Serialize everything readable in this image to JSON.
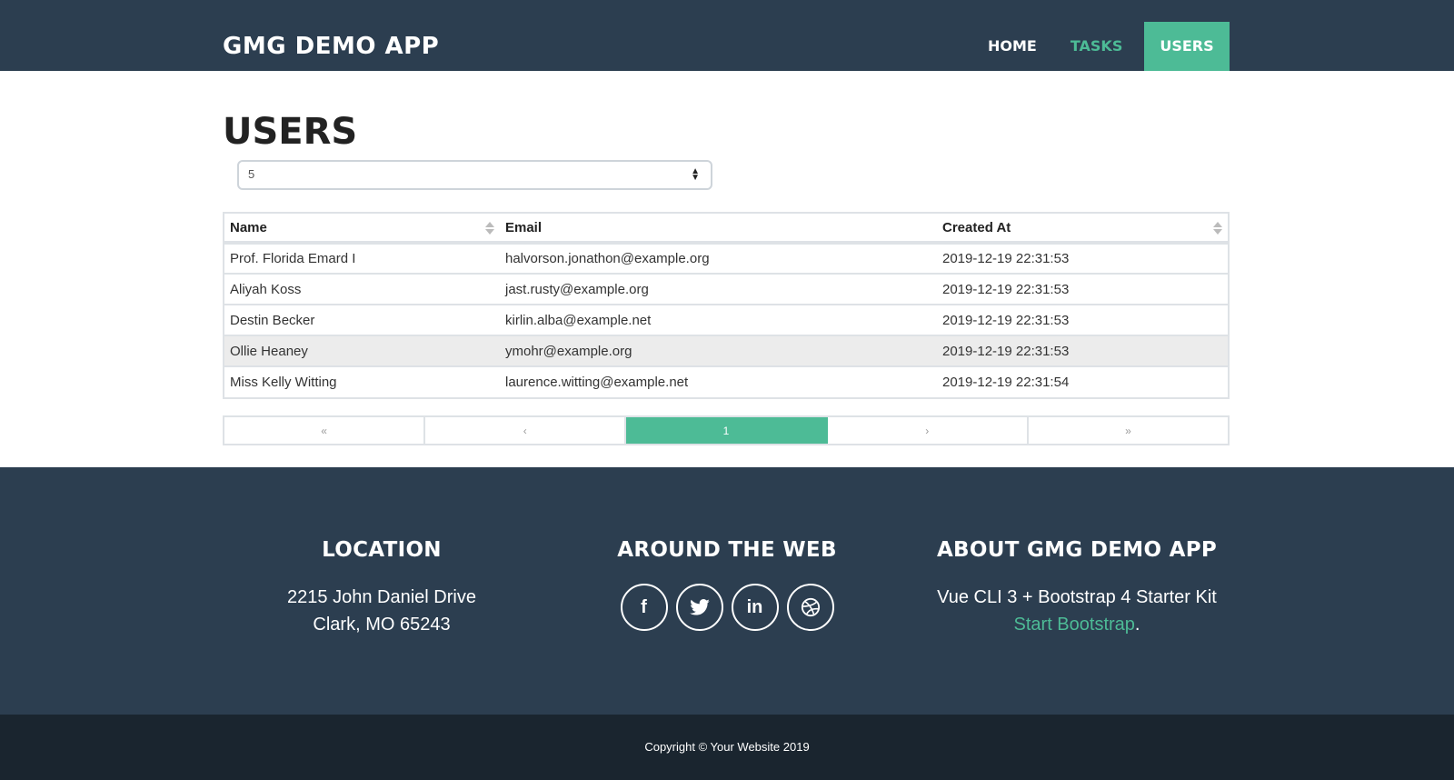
{
  "navbar": {
    "brand": "GMG DEMO APP",
    "links": [
      {
        "label": "HOME"
      },
      {
        "label": "TASKS"
      },
      {
        "label": "USERS"
      }
    ]
  },
  "main": {
    "title": "USERS",
    "per_page": "5",
    "table": {
      "headers": [
        "Name",
        "Email",
        "Created At"
      ],
      "rows": [
        {
          "name": "Prof. Florida Emard I",
          "email": "halvorson.jonathon@example.org",
          "created_at": "2019-12-19 22:31:53"
        },
        {
          "name": "Aliyah Koss",
          "email": "jast.rusty@example.org",
          "created_at": "2019-12-19 22:31:53"
        },
        {
          "name": "Destin Becker",
          "email": "kirlin.alba@example.net",
          "created_at": "2019-12-19 22:31:53"
        },
        {
          "name": "Ollie Heaney",
          "email": "ymohr@example.org",
          "created_at": "2019-12-19 22:31:53"
        },
        {
          "name": "Miss Kelly Witting",
          "email": "laurence.witting@example.net",
          "created_at": "2019-12-19 22:31:54"
        }
      ]
    },
    "pagination": {
      "first": "«",
      "prev": "‹",
      "current": "1",
      "next": "›",
      "last": "»"
    }
  },
  "footer": {
    "location": {
      "heading": "LOCATION",
      "line1": "2215 John Daniel Drive",
      "line2": "Clark, MO 65243"
    },
    "web": {
      "heading": "AROUND THE WEB",
      "icons": [
        "facebook-icon",
        "twitter-icon",
        "linkedin-icon",
        "dribbble-icon"
      ]
    },
    "about": {
      "heading": "ABOUT GMG DEMO APP",
      "text": "Vue CLI 3 + Bootstrap 4 Starter Kit",
      "link": "Start Bootstrap",
      "suffix": "."
    },
    "copyright": "Copyright © Your Website 2019"
  },
  "colors": {
    "primary": "#2c3e50",
    "accent": "#4dbb96",
    "dark": "#1a252f"
  }
}
